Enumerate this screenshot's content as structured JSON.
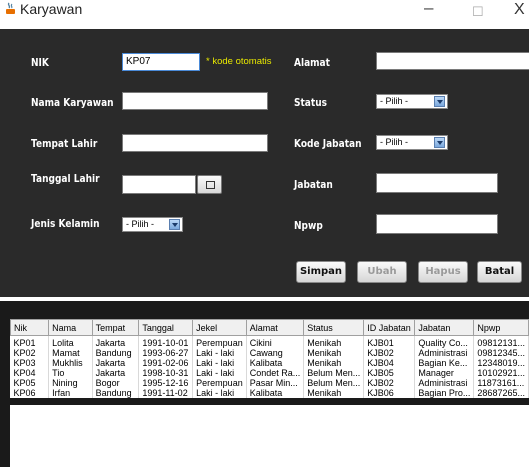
{
  "window": {
    "title": "Karyawan",
    "minimize_glyph": "–",
    "maximize_glyph": "☐",
    "close_glyph": "X"
  },
  "form": {
    "nik_label": "NIK",
    "nik_value": "KP07",
    "nik_hint": "* kode otomatis",
    "nama_label": "Nama Karyawan",
    "tempat_label": "Tempat Lahir",
    "tanggal_label": "Tanggal Lahir",
    "jenis_label": "Jenis Kelamin",
    "jenis_value": "- Pilih -",
    "alamat_label": "Alamat",
    "status_label": "Status",
    "status_value": "- Pilih -",
    "kode_jabatan_label": "Kode Jabatan",
    "kode_jabatan_value": "- Pilih -",
    "jabatan_label": "Jabatan",
    "npwp_label": "Npwp"
  },
  "buttons": {
    "simpan": "Simpan",
    "ubah": "Ubah",
    "hapus": "Hapus",
    "batal": "Batal"
  },
  "table": {
    "columns": [
      "Nik",
      "Nama",
      "Tempat",
      "Tanggal",
      "Jekel",
      "Alamat",
      "Status",
      "ID Jabatan",
      "Jabatan",
      "Npwp"
    ],
    "rows": [
      [
        "KP01",
        "Lolita",
        "Jakarta",
        "1991-10-01",
        "Perempuan",
        "Cikini",
        "Menikah",
        "KJB01",
        "Quality Co...",
        "09812131..."
      ],
      [
        "KP02",
        "Mamat",
        "Bandung",
        "1993-06-27",
        "Laki - laki",
        "Cawang",
        "Menikah",
        "KJB02",
        "Administrasi",
        "09812345..."
      ],
      [
        "KP03",
        "Mukhlis",
        "Jakarta",
        "1991-02-06",
        "Laki - laki",
        "Kalibata",
        "Menikah",
        "KJB04",
        "Bagian Ke...",
        "12348019..."
      ],
      [
        "KP04",
        "Tio",
        "Jakarta",
        "1998-10-31",
        "Laki - laki",
        "Condet Ra...",
        "Belum Men...",
        "KJB05",
        "Manager",
        "10102921..."
      ],
      [
        "KP05",
        "Nining",
        "Bogor",
        "1995-12-16",
        "Perempuan",
        "Pasar Min...",
        "Belum Men...",
        "KJB02",
        "Administrasi",
        "11873161..."
      ],
      [
        "KP06",
        "Irfan",
        "Bandung",
        "1991-11-02",
        "Laki - laki",
        "Kalibata",
        "Menikah",
        "KJB06",
        "Bagian Pro...",
        "28687265..."
      ]
    ]
  },
  "colors": {
    "form_background": "#2a2a2a",
    "table_panel_background": "#1a1a1a",
    "hint_text": "#e8e800",
    "label_text": "#ffffff"
  }
}
